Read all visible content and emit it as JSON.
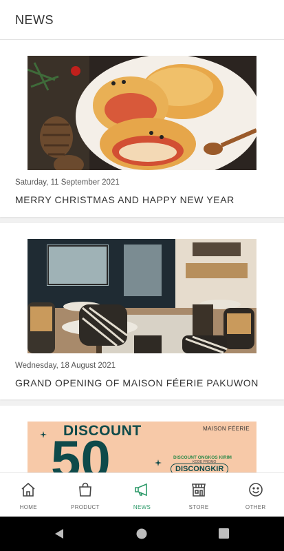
{
  "header": {
    "title": "NEWS"
  },
  "news": [
    {
      "date": "Saturday, 11 September 2021",
      "title": "MERRY CHRISTMAS AND HAPPY NEW YEAR"
    },
    {
      "date": "Wednesday, 18 August 2021",
      "title": "GRAND OPENING OF MAISON FÉERIE PAKUWON"
    },
    {
      "banner": {
        "headline": "DISCOUNT",
        "number": "50",
        "brand": "MAISON FÉERIE",
        "promo_line": "DISCOUNT ONGKOS KIRIM",
        "promo_sub": "KODE PROMO",
        "promo_code": "DISCONGKIR"
      }
    }
  ],
  "nav": {
    "items": [
      {
        "label": "HOME",
        "icon": "home-icon"
      },
      {
        "label": "PRODUCT",
        "icon": "shopping-bag-icon"
      },
      {
        "label": "NEWS",
        "icon": "megaphone-icon",
        "active": true
      },
      {
        "label": "STORE",
        "icon": "store-icon"
      },
      {
        "label": "OTHER",
        "icon": "smiley-icon"
      }
    ]
  },
  "colors": {
    "accent": "#2e9a6a",
    "banner_bg": "#f7c9a8",
    "banner_text": "#0e4a4a"
  }
}
